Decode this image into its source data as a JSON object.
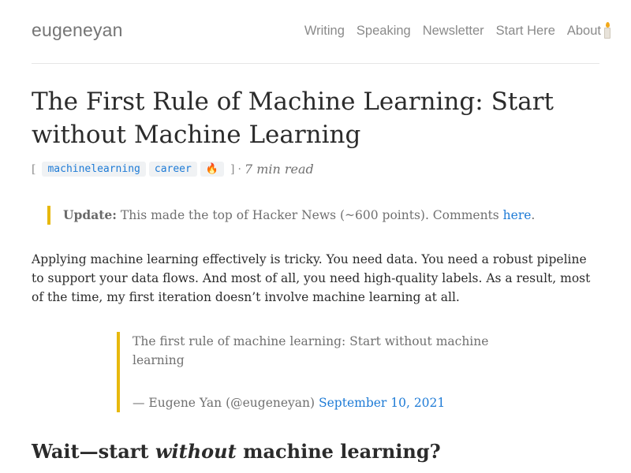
{
  "site": {
    "title": "eugeneyan"
  },
  "nav": {
    "items": [
      "Writing",
      "Speaking",
      "Newsletter",
      "Start Here",
      "About"
    ],
    "candle_icon": "candle-icon"
  },
  "article": {
    "title": "The First Rule of Machine Learning: Start without Machine Learning",
    "meta": {
      "bracket_open": "[",
      "tags": [
        "machinelearning",
        "career"
      ],
      "emoji": "🔥",
      "bracket_close": "]",
      "separator": "·",
      "read_time": "7 min read"
    },
    "update": {
      "label": "Update:",
      "text": "This made the top of Hacker News (~600 points). Comments",
      "link": "here",
      "period": "."
    },
    "paragraph": "Applying machine learning effectively is tricky. You need data. You need a robust pipeline to support your data flows. And most of all, you need high-quality labels. As a result, most of the time, my first iteration doesn’t involve machine learning at all.",
    "quote": {
      "text": "The first rule of machine learning: Start without machine learning",
      "attribution": "— Eugene Yan (@eugeneyan)",
      "date_link": "September 10, 2021"
    },
    "heading": {
      "pre": "Wait—start",
      "em": "without",
      "post": "machine learning?"
    }
  },
  "colors": {
    "accent_link": "#1e7bd6",
    "blockquote_border": "#e7b80d",
    "tag_bg": "#f0f2f4",
    "text": "#2b2b2b",
    "muted": "#8a8a8a"
  }
}
